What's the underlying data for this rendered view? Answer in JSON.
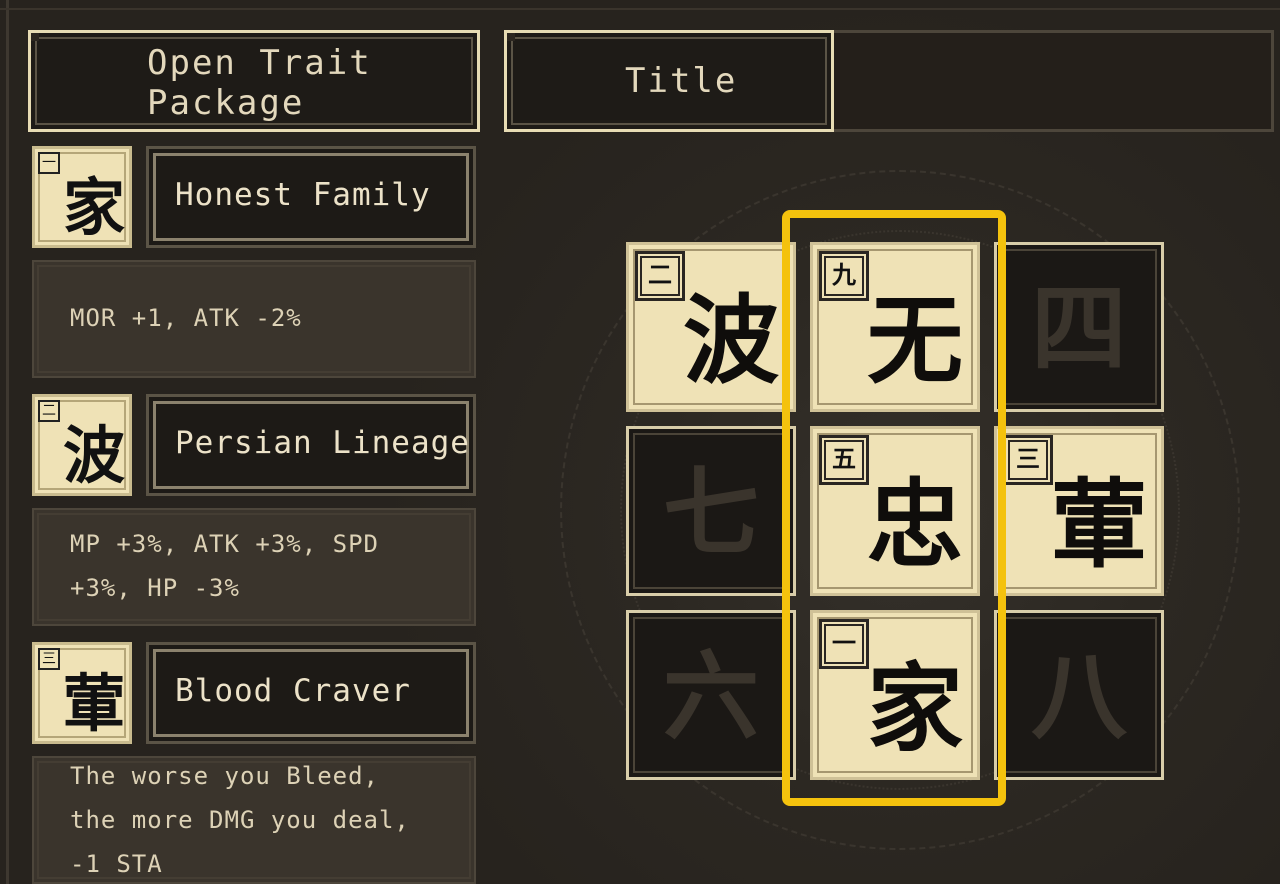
{
  "header": {
    "open_trait_line1": "Open Trait",
    "open_trait_line2": "Package",
    "title_label": "Title"
  },
  "traits": [
    {
      "glyph": "家",
      "index_glyph": "一",
      "name": "Honest Family",
      "desc": "MOR +1, ATK -2%"
    },
    {
      "glyph": "波",
      "index_glyph": "二",
      "name": "Persian Lineage",
      "desc": "MP +3%, ATK +3%, SPD\n+3%, HP -3%"
    },
    {
      "glyph": "葷",
      "index_glyph": "三",
      "name": "Blood Craver",
      "desc": "The worse you Bleed,\nthe more DMG you deal,\n-1 STA"
    }
  ],
  "grid": [
    {
      "state": "filled",
      "glyph": "波",
      "num": "二"
    },
    {
      "state": "filled",
      "glyph": "无",
      "num": "九"
    },
    {
      "state": "empty",
      "glyph": "四",
      "num": ""
    },
    {
      "state": "empty",
      "glyph": "七",
      "num": ""
    },
    {
      "state": "filled",
      "glyph": "忠",
      "num": "五"
    },
    {
      "state": "filled",
      "glyph": "葷",
      "num": "三"
    },
    {
      "state": "empty",
      "glyph": "六",
      "num": ""
    },
    {
      "state": "filled",
      "glyph": "家",
      "num": "一"
    },
    {
      "state": "empty",
      "glyph": "八",
      "num": ""
    }
  ],
  "colors": {
    "highlight": "#f4c20d",
    "tile_light": "#efe2b6",
    "tile_dark": "#1b1815",
    "background": "#2b2620"
  }
}
